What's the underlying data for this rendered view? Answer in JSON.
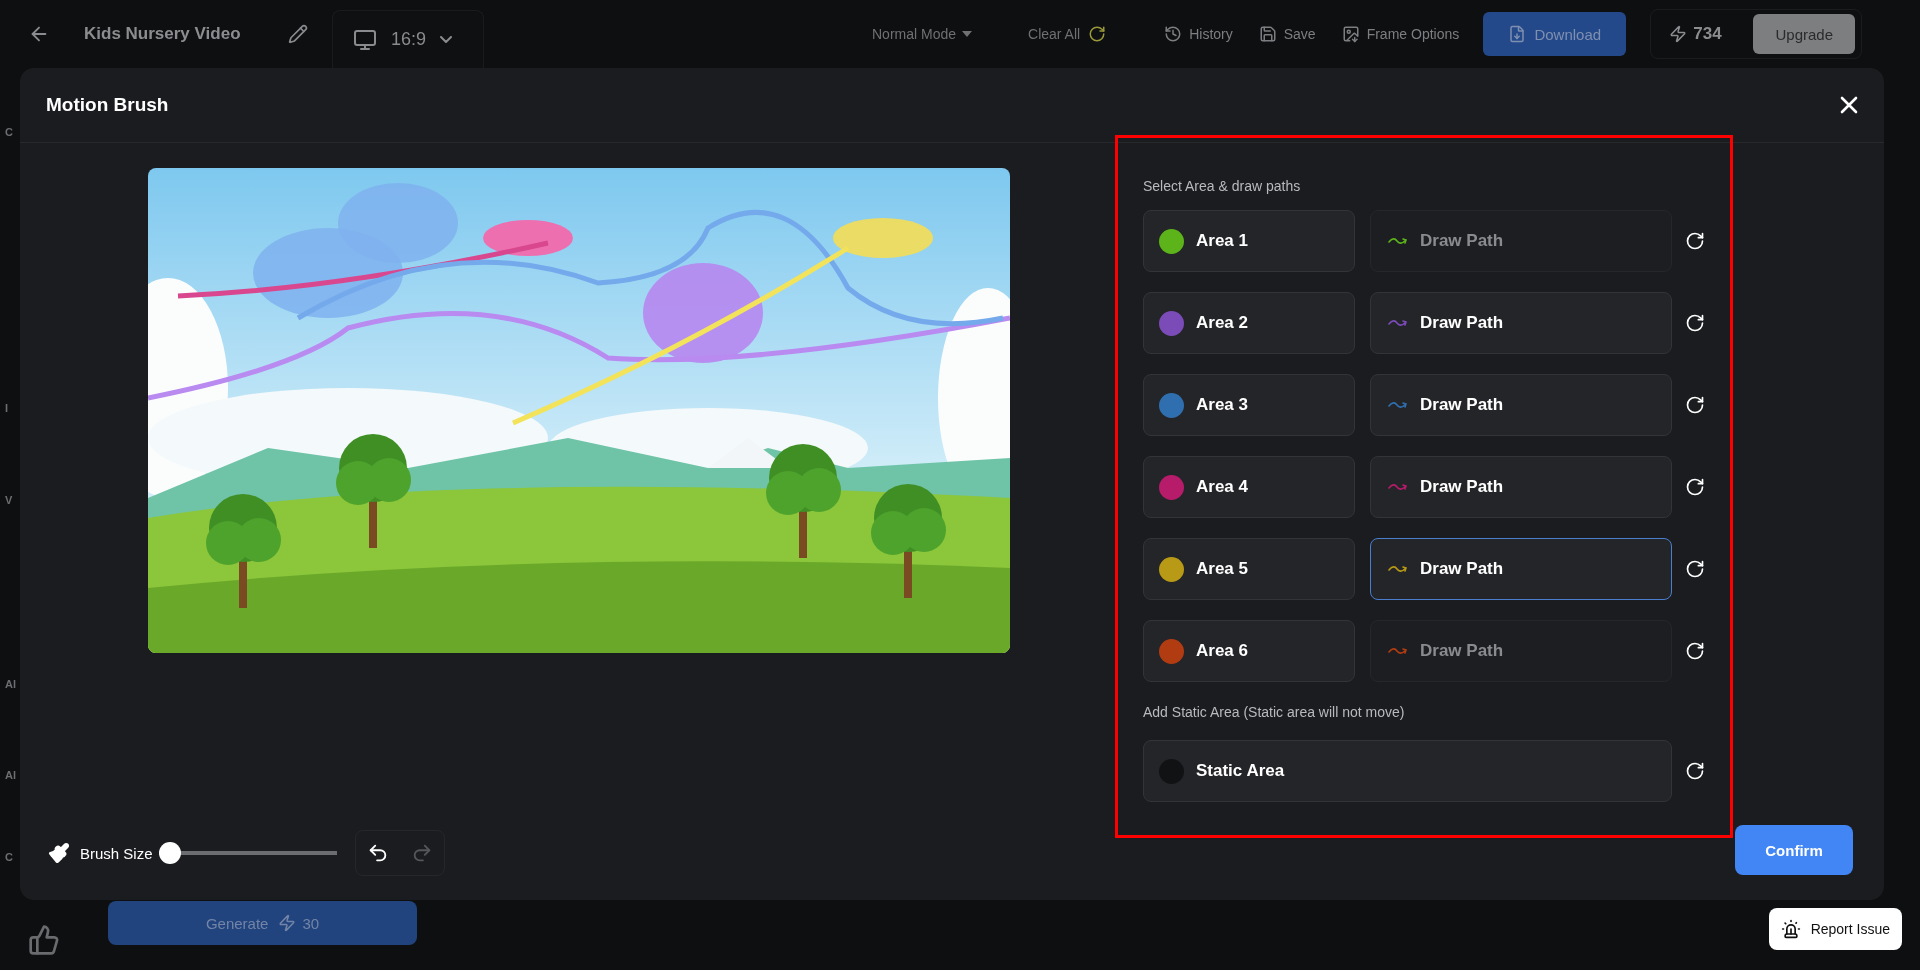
{
  "top_bar": {
    "title": "Kids Nursery Video",
    "aspect_ratio": "16:9",
    "mode": "Normal Mode",
    "clear_all": "Clear All",
    "actions": [
      {
        "label": "History",
        "kind": "history"
      },
      {
        "label": "Save",
        "kind": "save"
      },
      {
        "label": "Frame Options",
        "kind": "frame"
      }
    ],
    "download": "Download",
    "credits": "734",
    "upgrade": "Upgrade"
  },
  "background_labels": [
    "C",
    "I",
    "V",
    "Al",
    "Al",
    "C"
  ],
  "modal": {
    "title": "Motion Brush",
    "brush_size": {
      "label": "Brush Size",
      "level": 0
    },
    "undo": {
      "disabled": false
    },
    "redo": {
      "disabled": true
    },
    "panel": {
      "heading": "Select Area & draw paths",
      "areas": [
        {
          "label": "Area 1",
          "color": "#5cb31a",
          "path_label": "Draw Path",
          "path_disabled": true,
          "path_selected": false
        },
        {
          "label": "Area 2",
          "color": "#7b4bb8",
          "path_label": "Draw Path",
          "path_disabled": false,
          "path_selected": false
        },
        {
          "label": "Area 3",
          "color": "#2f6fb0",
          "path_label": "Draw Path",
          "path_disabled": false,
          "path_selected": false
        },
        {
          "label": "Area 4",
          "color": "#b71c6b",
          "path_label": "Draw Path",
          "path_disabled": false,
          "path_selected": false
        },
        {
          "label": "Area 5",
          "color": "#b89a16",
          "path_label": "Draw Path",
          "path_disabled": false,
          "path_selected": true
        },
        {
          "label": "Area 6",
          "color": "#b23c12",
          "path_label": "Draw Path",
          "path_disabled": true,
          "path_selected": false
        }
      ],
      "static_heading": "Add Static Area (Static area will not move)",
      "static_area": {
        "label": "Static Area",
        "color": "#111214"
      }
    },
    "confirm": "Confirm"
  },
  "generate": {
    "label": "Generate",
    "cost": "30"
  },
  "report_issue": "Report Issue"
}
